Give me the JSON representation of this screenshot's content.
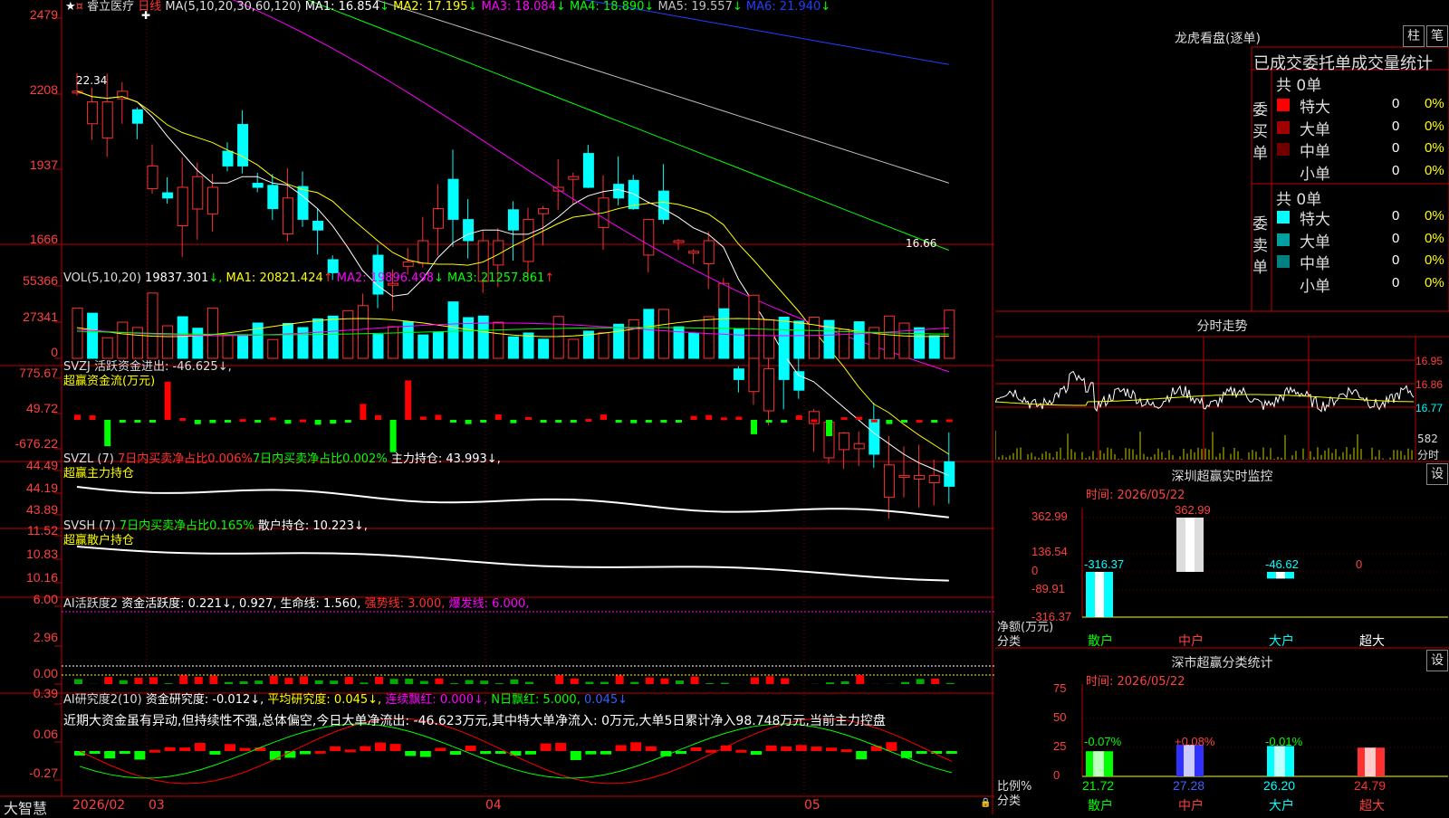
{
  "stock": {
    "name": "睿立医疗",
    "period": "日线",
    "ma_header": "MA(5,10,20,30,60,120)",
    "ma": [
      {
        "label": "MA1:",
        "value": "16.854",
        "arrow": "↓",
        "color": "#ffffff"
      },
      {
        "label": "MA2:",
        "value": "17.195",
        "arrow": "↓",
        "color": "#ffff00"
      },
      {
        "label": "MA3:",
        "value": "18.084",
        "arrow": "↓",
        "color": "#ff00ff"
      },
      {
        "label": "MA4:",
        "value": "18.890",
        "arrow": "↓",
        "color": "#00ff00"
      },
      {
        "label": "MA5:",
        "value": "19.557",
        "arrow": "↓",
        "color": "#c0c0c0"
      },
      {
        "label": "MA6:",
        "value": "21.940",
        "arrow": "↓",
        "color": "#2040ff"
      }
    ],
    "price_axis": [
      "2479",
      "2208",
      "1937",
      "1666"
    ],
    "price_hi_label": "22.34",
    "price_lo_label": "16.66"
  },
  "vol": {
    "header": "VOL(5,10,20)",
    "value": "19837.301",
    "ma": [
      {
        "label": "MA1:",
        "value": "20821.424",
        "arrow": "↑",
        "color": "#ffff00"
      },
      {
        "label": "MA2:",
        "value": "19896.498",
        "arrow": "↓",
        "color": "#ff00ff"
      },
      {
        "label": "MA3:",
        "value": "21257.861",
        "arrow": "↑",
        "color": "#00ff00"
      }
    ],
    "axis": [
      "55366",
      "27341",
      "0"
    ]
  },
  "svzj": {
    "line1": "SVZJ  活跃资金进出: -46.625↓,",
    "line2": "超赢资金流(万元)",
    "axis": [
      "775.67",
      "49.72",
      "-676.22"
    ]
  },
  "svzl": {
    "prefix": "SVZL (7)",
    "a": "7日内买卖净占比0.006%",
    "b": "7日内买卖净占比0.002%",
    "c": "主力持仓: 43.993↓,",
    "line2": "超赢主力持仓",
    "axis": [
      "44.49",
      "44.19",
      "43.89"
    ]
  },
  "svsh": {
    "prefix": "SVSH (7)",
    "a": "7日内买卖净占比0.165%",
    "b": "散户持仓: 10.223↓,",
    "line2": "超赢散户持仓",
    "axis": [
      "11.52",
      "10.83",
      "10.16"
    ]
  },
  "ai1": {
    "prefix": "AI活跃度2",
    "a": "资金活跃度: 0.221↓,",
    "b": "0.927,",
    "c": "生命线: 1.560,",
    "d": "强势线: 3.000,",
    "e": "爆发线: 6.000,",
    "axis": [
      "6.00",
      "2.96",
      "0.00"
    ]
  },
  "ai2": {
    "prefix": "AI研究度2(10)",
    "a": "资金研究度: -0.012↓,",
    "b": "平均研究度: 0.045↓,",
    "c": "连续飘红: 0.000↓,",
    "d": "N日飘红: 5.000,",
    "e": "0.045↓",
    "text": "近期大资金虽有异动,但持续性不强,总体偏空,今日大单净流出: -46.623万元,其中特大单净流入: 0万元,大单5日累计净入98.748万元,当前主力控盘",
    "axis": [
      "0.39",
      "0.06",
      "-0.27"
    ]
  },
  "bottom": {
    "brand": "大智慧",
    "date": "2026/02",
    "months": [
      "03",
      "04",
      "05"
    ]
  },
  "right": {
    "lhb_title": "龙虎看盘(逐单)",
    "btn1": "柱",
    "btn2": "笔",
    "table_header": "已成交委托单成交量统计",
    "buy_label": "委买单",
    "sell_label": "委卖单",
    "buy_total": "共 0单",
    "sell_total": "共 0单",
    "buy_rows": [
      {
        "name": "特大",
        "v": "0",
        "p": "0%",
        "color": "#ff0000"
      },
      {
        "name": "大单",
        "v": "0",
        "p": "0%",
        "color": "#a00000"
      },
      {
        "name": "中单",
        "v": "0",
        "p": "0%",
        "color": "#700000"
      },
      {
        "name": "小单",
        "v": "0",
        "p": "0%",
        "color": "#000000"
      }
    ],
    "sell_rows": [
      {
        "name": "特大",
        "v": "0",
        "p": "0%",
        "color": "#00ffff"
      },
      {
        "name": "大单",
        "v": "0",
        "p": "0%",
        "color": "#00a0a0"
      },
      {
        "name": "中单",
        "v": "0",
        "p": "0%",
        "color": "#008080"
      },
      {
        "name": "小单",
        "v": "0",
        "p": "0%",
        "color": "#000000"
      }
    ],
    "intraday_title": "分时走势",
    "intraday_axis": [
      "16.95",
      "16.86",
      "16.77"
    ],
    "intraday_vol": "582",
    "intraday_unit": "分时",
    "sz_title": "深圳超赢实时监控",
    "set": "设",
    "time": "时间: 2026/05/22",
    "sz_axis": [
      "362.99",
      "136.54",
      "0",
      "-89.91",
      "-316.37"
    ],
    "sz_ylabel": "净额(万元)",
    "sz_xlabel": "分类",
    "sz_cats": [
      "散户",
      "中户",
      "大户",
      "超大"
    ],
    "sz_values": [
      -316.37,
      362.99,
      -46.62,
      0
    ],
    "sz_value_labels": [
      "-316.37",
      "362.99",
      "-46.62",
      "0"
    ],
    "sh_title": "深市超赢分类统计",
    "sh_time": "时间: 2026/05/22",
    "sh_axis": [
      "75",
      "50",
      "25",
      "0"
    ],
    "sh_ylabel": "比例%",
    "sh_xlabel": "分类",
    "sh_cats": [
      "散户",
      "中户",
      "大户",
      "超大"
    ],
    "sh_values": [
      21.72,
      27.28,
      26.2,
      24.79
    ],
    "sh_value_labels": [
      "21.72",
      "27.28",
      "26.20",
      "24.79"
    ],
    "sh_changes": [
      "-0.07%",
      "+0.08%",
      "-0.01%",
      ""
    ],
    "sh_colors": [
      "#00ff00",
      "#3030ff",
      "#00ffff",
      "#ff3030"
    ]
  }
}
